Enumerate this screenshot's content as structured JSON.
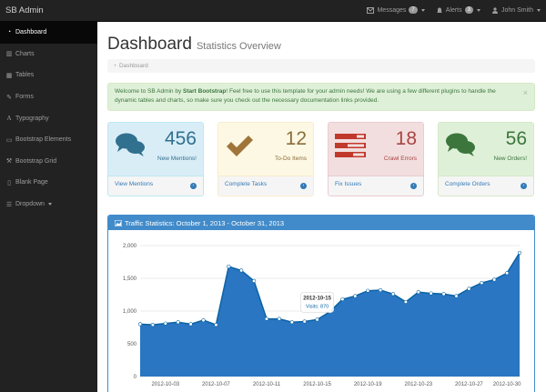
{
  "navbar": {
    "brand": "SB Admin",
    "messages": {
      "label": "Messages",
      "count": "7"
    },
    "alerts": {
      "label": "Alerts",
      "count": "3"
    },
    "user": {
      "label": "John Smith"
    }
  },
  "sidebar": {
    "items": [
      {
        "label": "Dashboard",
        "icon": "dashboard-icon",
        "glyph": "◔"
      },
      {
        "label": "Charts",
        "icon": "bar-chart-icon",
        "glyph": "▥"
      },
      {
        "label": "Tables",
        "icon": "table-icon",
        "glyph": "▦"
      },
      {
        "label": "Forms",
        "icon": "edit-icon",
        "glyph": "✎"
      },
      {
        "label": "Typography",
        "icon": "font-icon",
        "glyph": "A"
      },
      {
        "label": "Bootstrap Elements",
        "icon": "desktop-icon",
        "glyph": "▭"
      },
      {
        "label": "Bootstrap Grid",
        "icon": "wrench-icon",
        "glyph": "⚒"
      },
      {
        "label": "Blank Page",
        "icon": "file-icon",
        "glyph": "▯"
      },
      {
        "label": "Dropdown",
        "icon": "list-icon",
        "glyph": "☰"
      }
    ]
  },
  "header": {
    "title": "Dashboard",
    "subtitle": "Statistics Overview",
    "breadcrumb": "Dashboard"
  },
  "alert": {
    "pre": "Welcome to SB Admin by ",
    "bold": "Start Bootstrap",
    "post": "! Feel free to use this template for your admin needs! We are using a few different plugins to handle the dynamic tables and charts, so make sure you check out the necessary documentation links provided.",
    "close": "×"
  },
  "panels": [
    {
      "number": "456",
      "label": "New Mentions!",
      "footer": "View Mentions",
      "icon": "comments-icon"
    },
    {
      "number": "12",
      "label": "To-Do Items",
      "footer": "Complete Tasks",
      "icon": "check-icon"
    },
    {
      "number": "18",
      "label": "Crawl Errors",
      "footer": "Fix Issues",
      "icon": "tasks-icon"
    },
    {
      "number": "56",
      "label": "New Orders!",
      "footer": "Complete Orders",
      "icon": "comments-icon"
    }
  ],
  "colors": {
    "chart_fill": "#1f6fbf",
    "chart_header": "#428bca"
  },
  "chart_data": {
    "type": "area",
    "title": "Traffic Statistics: October 1, 2013 - October 31, 2013",
    "x_tick_labels": [
      "2012-10-03",
      "2012-10-07",
      "2012-10-11",
      "2012-10-15",
      "2012-10-19",
      "2012-10-23",
      "2012-10-27",
      "2012-10-30"
    ],
    "y_tick_labels": [
      "0",
      "500",
      "1,000",
      "1,500",
      "2,000"
    ],
    "ylim": [
      0,
      2000
    ],
    "x": [
      "2012-10-01",
      "2012-10-02",
      "2012-10-03",
      "2012-10-04",
      "2012-10-05",
      "2012-10-06",
      "2012-10-07",
      "2012-10-08",
      "2012-10-09",
      "2012-10-10",
      "2012-10-11",
      "2012-10-12",
      "2012-10-13",
      "2012-10-14",
      "2012-10-15",
      "2012-10-16",
      "2012-10-17",
      "2012-10-18",
      "2012-10-19",
      "2012-10-20",
      "2012-10-21",
      "2012-10-22",
      "2012-10-23",
      "2012-10-24",
      "2012-10-25",
      "2012-10-26",
      "2012-10-27",
      "2012-10-28",
      "2012-10-29",
      "2012-10-30",
      "2012-10-31"
    ],
    "values": [
      800,
      790,
      810,
      830,
      800,
      860,
      790,
      1680,
      1620,
      1460,
      880,
      880,
      830,
      840,
      870,
      990,
      1180,
      1230,
      1310,
      1320,
      1260,
      1140,
      1290,
      1270,
      1260,
      1230,
      1340,
      1430,
      1480,
      1580,
      1890
    ],
    "tooltip": {
      "date": "2012-10-15",
      "text": "Visits: 870"
    },
    "grid": true
  }
}
